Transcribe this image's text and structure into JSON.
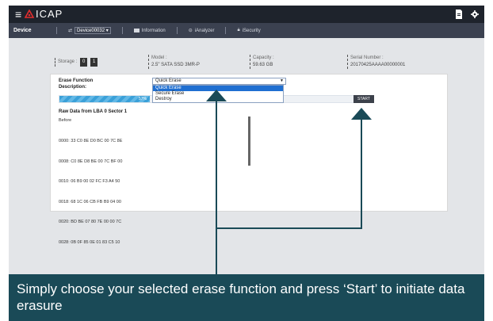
{
  "app": {
    "logo_text": "ICAP",
    "logo_mark": "≜"
  },
  "topbar": {
    "menu_icon": "hamburger-icon",
    "doc_icon": "document-icon",
    "settings_icon": "gear-icon"
  },
  "nav": {
    "device_label": "Device",
    "device_selector": "Device00032",
    "information_label": "Information",
    "ianalyzer_label": "iAnalyzer",
    "isecurity_label": "iSecurity"
  },
  "info": {
    "storage_label": "Storage :",
    "storage_buttons": [
      "0",
      "1"
    ],
    "model_label": "Model :",
    "model_value": "2.5\" SATA SSD 3MR-P",
    "capacity_label": "Capacity :",
    "capacity_value": "59.63 GB",
    "serial_label": "Serial Number :",
    "serial_value": "20170425AAAA00000001"
  },
  "erase": {
    "function_label": "Erase Function",
    "description_label": "Description:",
    "selected": "Quick Erase",
    "options": [
      "Quick Erase",
      "Secure Erase",
      "Destroy"
    ],
    "progress_percent": 57,
    "progress_text": "57%",
    "start_label": "START"
  },
  "raw": {
    "title": "Raw Data from LBA 0 Sector 1",
    "before_label": "Before",
    "lines": [
      "0000: 33 C0 8E D0 BC 00 7C 8E",
      "0008: C0 8E D8 BE 00 7C BF 00",
      "0010: 06 B9 00 02 FC F3 A4 50",
      "0018: 68 1C 06 CB FB B9 04 00",
      "0020: BD BE 07 80 7E 00 00 7C",
      "0028: 0B 0F 85 0E 01 83 C5 10"
    ]
  },
  "caption": {
    "text": "Simply choose your selected erase function and press ‘Start’ to initiate data erasure"
  }
}
